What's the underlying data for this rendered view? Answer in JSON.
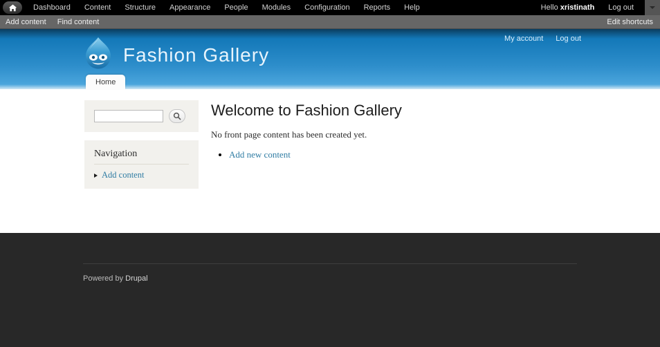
{
  "admin_toolbar": {
    "home_icon": "home-icon",
    "menu_items": [
      {
        "label": "Dashboard"
      },
      {
        "label": "Content"
      },
      {
        "label": "Structure"
      },
      {
        "label": "Appearance"
      },
      {
        "label": "People"
      },
      {
        "label": "Modules"
      },
      {
        "label": "Configuration"
      },
      {
        "label": "Reports"
      },
      {
        "label": "Help"
      }
    ],
    "greeting_prefix": "Hello ",
    "username": "xristinath",
    "logout_label": "Log out",
    "dropdown_icon": "chevron-down-icon",
    "background_color": "#000000"
  },
  "shortcut_bar": {
    "items": [
      {
        "label": "Add content"
      },
      {
        "label": "Find content"
      }
    ],
    "edit_label": "Edit shortcuts",
    "background_color": "#666666"
  },
  "site_header": {
    "logo_icon": "drupal-droplet-icon",
    "site_name": "Fashion  Gallery",
    "user_links": [
      {
        "label": "My account"
      },
      {
        "label": "Log out"
      }
    ],
    "tabs": [
      {
        "label": "Home",
        "active": true
      }
    ],
    "gradient_top_color": "#0b3c5d",
    "gradient_bottom_color": "#4aa5dc"
  },
  "sidebar": {
    "search": {
      "icon": "search-icon",
      "value": "",
      "placeholder": ""
    },
    "navigation": {
      "title": "Navigation",
      "items": [
        {
          "label": "Add content"
        }
      ]
    },
    "block_background": "#f2f1ed"
  },
  "main": {
    "title": "Welcome to Fashion Gallery",
    "empty_message": "No front page content has been created yet.",
    "actions": [
      {
        "label": "Add new content"
      }
    ],
    "link_color": "#2f7ca3"
  },
  "footer": {
    "text_prefix": "Powered by ",
    "link_label": "Drupal",
    "background_color": "#282828"
  }
}
